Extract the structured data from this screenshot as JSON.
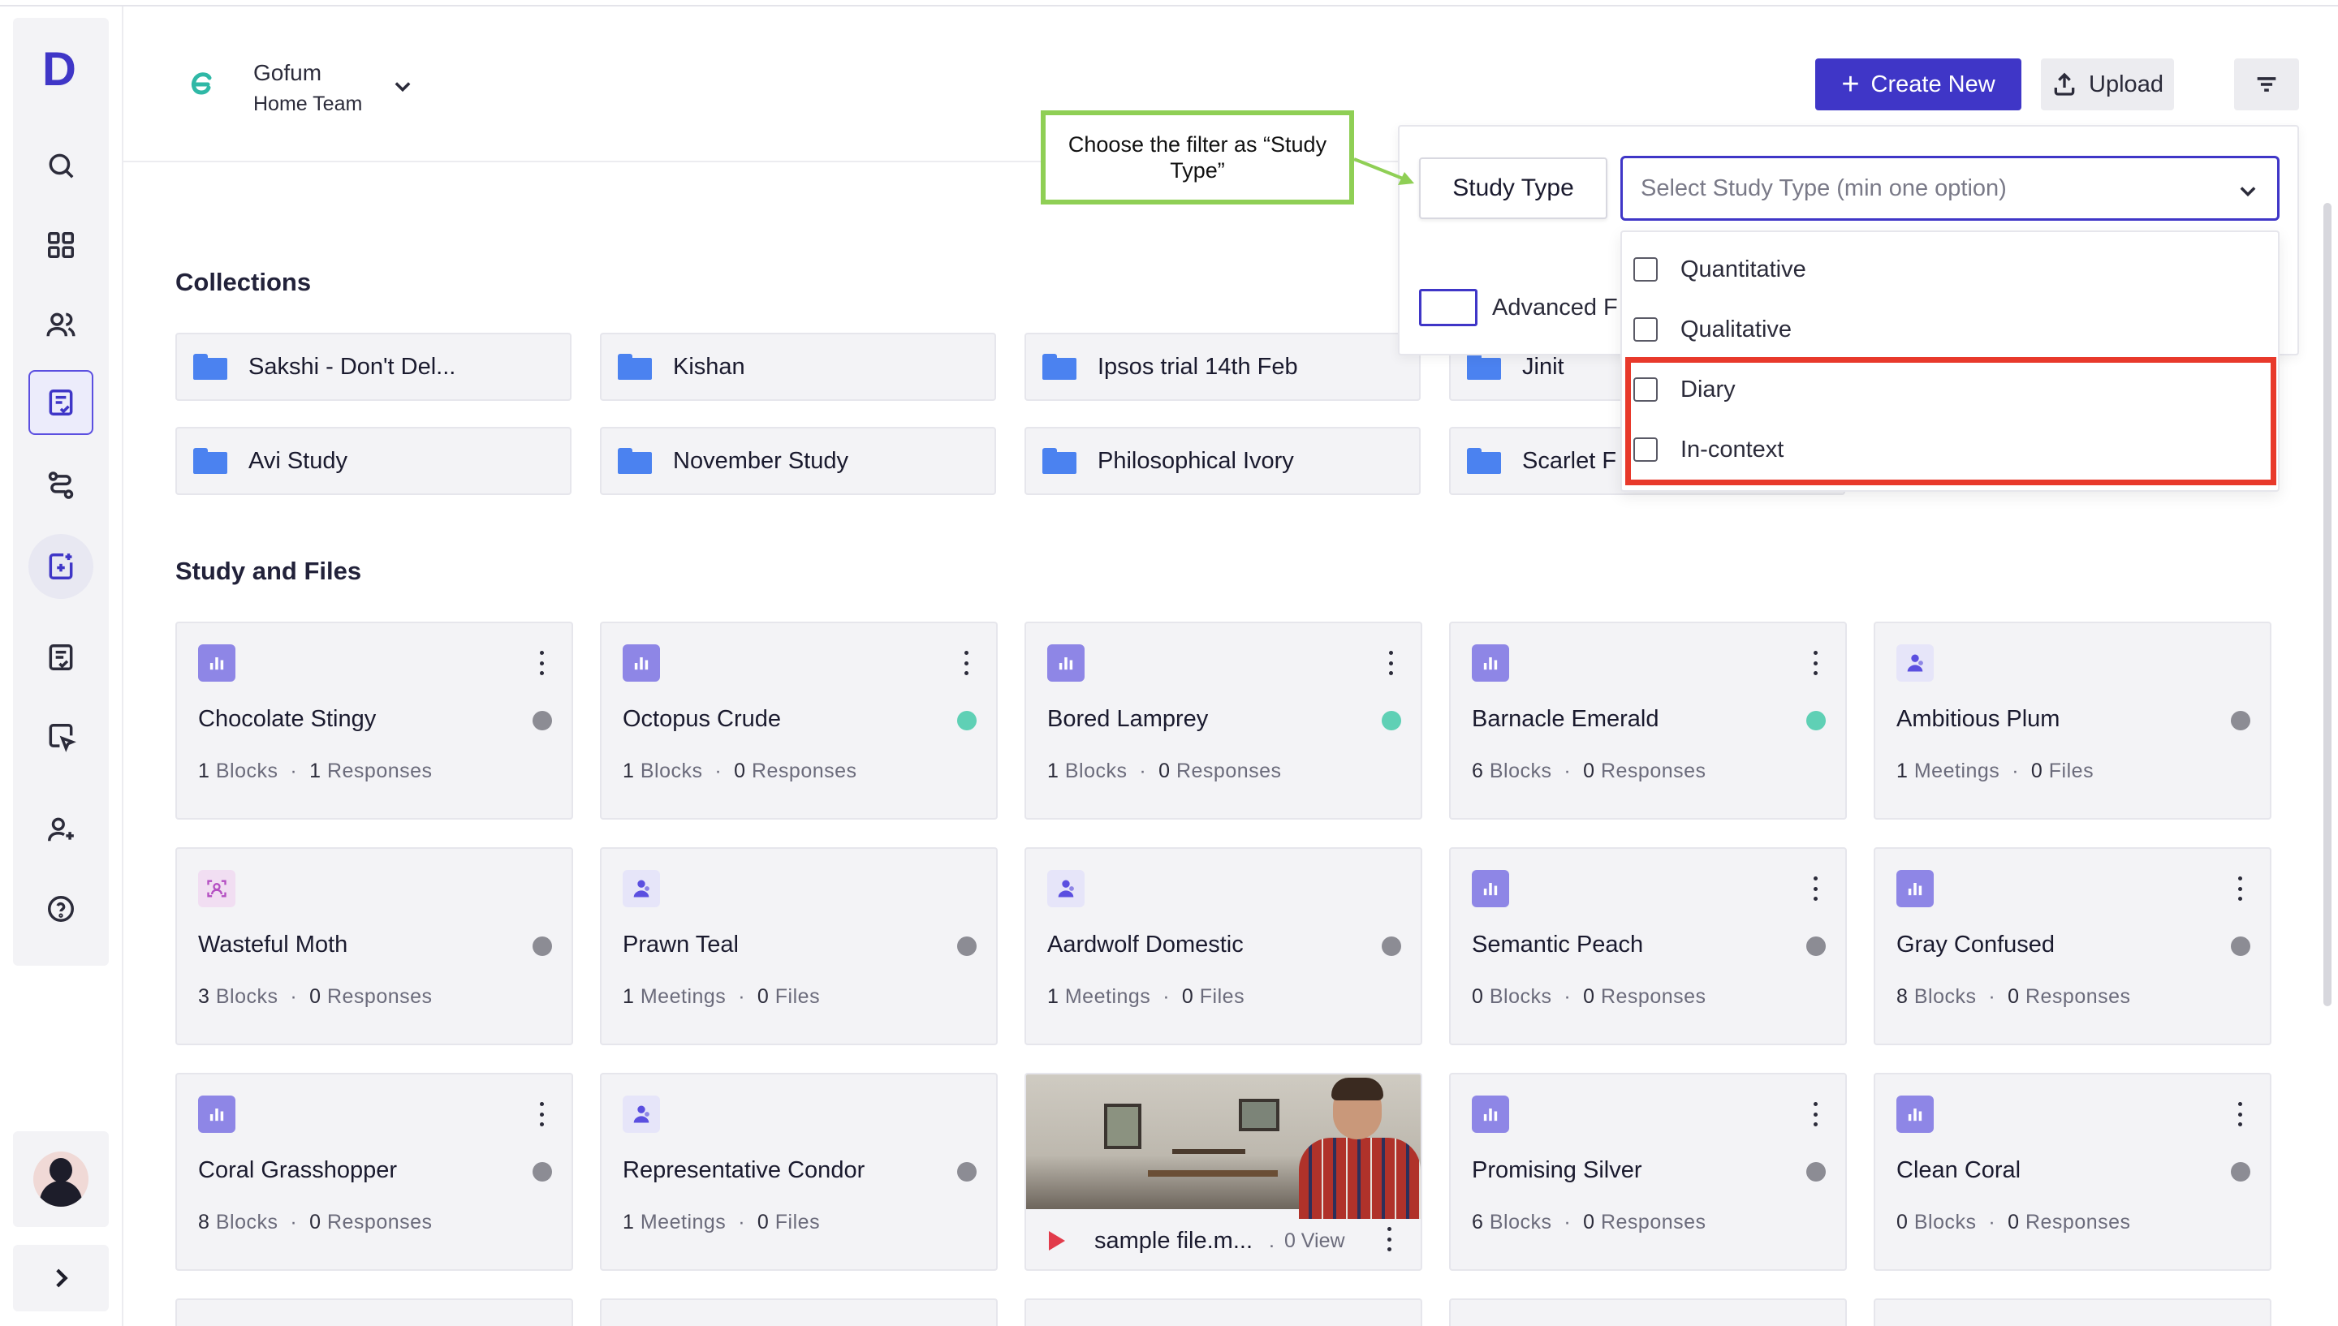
{
  "team": {
    "name": "Gofum",
    "sub": "Home Team"
  },
  "header": {
    "create_label": "Create New",
    "upload_label": "Upload"
  },
  "sections": {
    "collections": "Collections",
    "study_files": "Study and Files"
  },
  "collections": [
    "Sakshi - Don't Del...",
    "Kishan",
    "Ipsos trial 14th Feb",
    "Jinit",
    "Avi Study",
    "November Study",
    "Philosophical Ivory",
    "Scarlet F"
  ],
  "cards": [
    {
      "title": "Chocolate Stingy",
      "n1": "1",
      "u1": "Blocks",
      "n2": "1",
      "u2": "Responses",
      "icon": "survey-icon",
      "status": "#8c8c94"
    },
    {
      "title": "Octopus Crude",
      "n1": "1",
      "u1": "Blocks",
      "n2": "0",
      "u2": "Responses",
      "icon": "survey-icon",
      "status": "#5fd0b5"
    },
    {
      "title": "Bored Lamprey",
      "n1": "1",
      "u1": "Blocks",
      "n2": "0",
      "u2": "Responses",
      "icon": "survey-icon",
      "status": "#5fd0b5"
    },
    {
      "title": "Barnacle Emerald",
      "n1": "6",
      "u1": "Blocks",
      "n2": "0",
      "u2": "Responses",
      "icon": "survey-icon",
      "status": "#5fd0b5"
    },
    {
      "title": "Ambitious Plum",
      "n1": "1",
      "u1": "Meetings",
      "n2": "0",
      "u2": "Files",
      "icon": "meeting-icon",
      "status": "#8c8c94"
    },
    {
      "title": "Wasteful Moth",
      "n1": "3",
      "u1": "Blocks",
      "n2": "0",
      "u2": "Responses",
      "icon": "video-study-icon",
      "status": "#8c8c94"
    },
    {
      "title": "Prawn Teal",
      "n1": "1",
      "u1": "Meetings",
      "n2": "0",
      "u2": "Files",
      "icon": "meeting-icon",
      "status": "#8c8c94"
    },
    {
      "title": "Aardwolf Domestic",
      "n1": "1",
      "u1": "Meetings",
      "n2": "0",
      "u2": "Files",
      "icon": "meeting-icon",
      "status": "#8c8c94"
    },
    {
      "title": "Semantic Peach",
      "n1": "0",
      "u1": "Blocks",
      "n2": "0",
      "u2": "Responses",
      "icon": "survey-icon",
      "status": "#8c8c94"
    },
    {
      "title": "Gray Confused",
      "n1": "8",
      "u1": "Blocks",
      "n2": "0",
      "u2": "Responses",
      "icon": "survey-icon",
      "status": "#8c8c94"
    },
    {
      "title": "Coral Grasshopper",
      "n1": "8",
      "u1": "Blocks",
      "n2": "0",
      "u2": "Responses",
      "icon": "survey-icon",
      "status": "#8c8c94"
    },
    {
      "title": "Representative Condor",
      "n1": "1",
      "u1": "Meetings",
      "n2": "0",
      "u2": "Files",
      "icon": "meeting-icon",
      "status": "#8c8c94"
    },
    {
      "title": "Promising Silver",
      "n1": "6",
      "u1": "Blocks",
      "n2": "0",
      "u2": "Responses",
      "icon": "survey-icon",
      "status": "#8c8c94"
    },
    {
      "title": "Clean Coral",
      "n1": "0",
      "u1": "Blocks",
      "n2": "0",
      "u2": "Responses",
      "icon": "survey-icon",
      "status": "#8c8c94"
    }
  ],
  "file_card": {
    "name": "sample file.m...",
    "dot": ".",
    "views": "0 View"
  },
  "filter": {
    "study_type_label": "Study Type",
    "select_placeholder": "Select Study Type (min one option)",
    "advanced_label": "Advanced F",
    "options": [
      "Quantitative",
      "Qualitative",
      "Diary",
      "In-context"
    ]
  },
  "callout": {
    "text": "Choose the filter as “Study Type”"
  },
  "colors": {
    "accent": "#3f36c7",
    "highlight": "#e8392b",
    "callout_border": "#8fcf55"
  }
}
